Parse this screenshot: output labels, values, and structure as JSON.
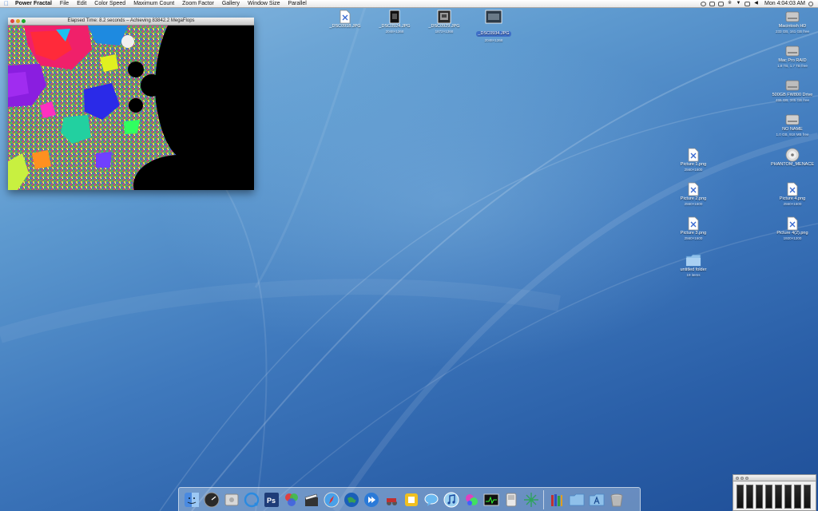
{
  "menubar": {
    "app_name": "Power Fractal",
    "items": [
      "File",
      "Edit",
      "Color Speed",
      "Maximum Count",
      "Zoom Factor",
      "Gallery",
      "Window Size",
      "Parallel"
    ],
    "clock": "Mon 4:04:03 AM"
  },
  "fractal_window": {
    "title": "Elapsed Time: 8.2 seconds – Achieving 83842.2 MegaFlops"
  },
  "desktop_icons_top": [
    {
      "label": "_DSC0918.JPG",
      "sub": "",
      "kind": "doc"
    },
    {
      "label": "_DSC0924.JPG",
      "sub": "2048×1368",
      "kind": "photo-dark"
    },
    {
      "label": "_DSC0929.JPG",
      "sub": "1872×1368",
      "kind": "photo-mid"
    },
    {
      "label": "_DSC0934.JPG",
      "sub": "2048×1368",
      "kind": "photo-sel"
    }
  ],
  "desktop_icons_right": [
    {
      "label": "Macintosh HD",
      "sub": "233 GB, 161 GB free",
      "kind": "drive"
    },
    {
      "label": "Mac Pro RAID",
      "sub": "1.8 TB, 1.7 TB free",
      "kind": "drive"
    },
    {
      "label": "500GB FW800 Drive",
      "sub": "465 GB, 345 GB free",
      "kind": "drive"
    },
    {
      "label": "NO NAME",
      "sub": "1.0 GB, 918 MB free",
      "kind": "drive"
    },
    {
      "label": "PHANTOM_MENACE",
      "sub": "",
      "kind": "disc"
    },
    {
      "label": "Picture 4.png",
      "sub": "2560×1600",
      "kind": "doc"
    },
    {
      "label": "Picture 4(2).png",
      "sub": "1920×1200",
      "kind": "doc"
    }
  ],
  "desktop_icons_middle": [
    {
      "label": "Picture 1.png",
      "sub": "2560×1600",
      "kind": "doc"
    },
    {
      "label": "Picture 2.png",
      "sub": "2560×1600",
      "kind": "doc"
    },
    {
      "label": "Picture 3.png",
      "sub": "2560×1600",
      "kind": "doc"
    },
    {
      "label": "untitled folder",
      "sub": "19 items",
      "kind": "folder"
    }
  ],
  "dock": {
    "apps": [
      "Finder",
      "Dashboard",
      "System Profiler",
      "QuickTime",
      "Photoshop",
      "Color Picker",
      "iMovie",
      "Safari",
      "Internet",
      "Front Row",
      "Automator",
      "Boot Camp",
      "iChat",
      "iTunes",
      "Fractal",
      "Activity Monitor",
      "Terminal",
      "Network"
    ],
    "docs": [
      "Books",
      "Applications Folder",
      "Documents",
      "Trash"
    ]
  },
  "colors": {
    "accent": "#3f6fc8",
    "desktop_dark": "#1f4f98",
    "desktop_light": "#8dbde2"
  }
}
